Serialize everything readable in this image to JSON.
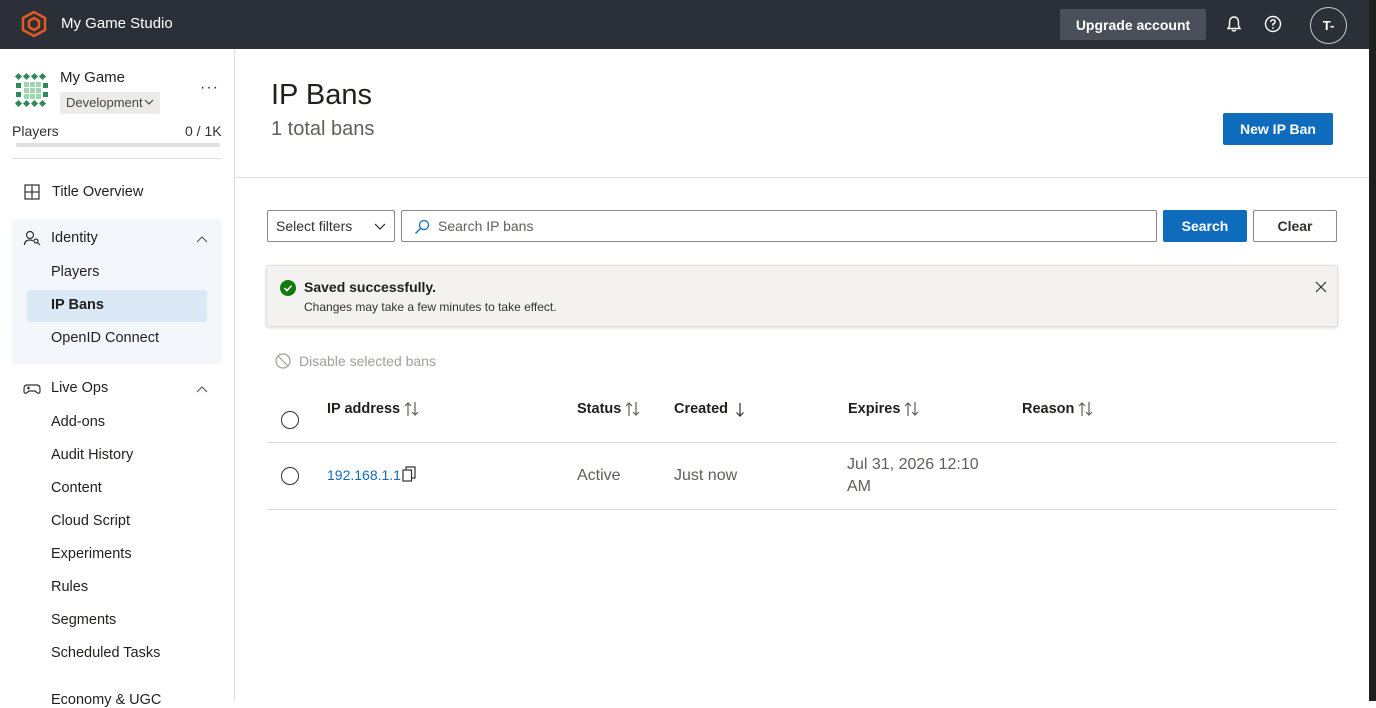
{
  "topbar": {
    "studio_name": "My Game Studio",
    "upgrade_label": "Upgrade account",
    "avatar_initials": "T-"
  },
  "sidebar": {
    "game_name": "My Game",
    "environment": "Development",
    "more_label": "···",
    "players_label": "Players",
    "players_count": "0 / 1K",
    "players_fraction": 0.0,
    "title_overview": "Title Overview",
    "identity": {
      "label": "Identity",
      "items": [
        "Players",
        "IP Bans",
        "OpenID Connect"
      ]
    },
    "live_ops": {
      "label": "Live Ops",
      "items": [
        "Add-ons",
        "Audit History",
        "Content",
        "Cloud Script",
        "Experiments",
        "Rules",
        "Segments",
        "Scheduled Tasks"
      ]
    },
    "partial_item": "Economy & UGC"
  },
  "main": {
    "title": "IP Bans",
    "subtitle": "1 total bans",
    "new_button": "New IP Ban",
    "filter_label": "Select filters",
    "search_placeholder": "Search IP bans",
    "search_button": "Search",
    "clear_button": "Clear",
    "toast": {
      "title": "Saved successfully.",
      "message": "Changes may take a few minutes to take effect."
    },
    "disable_label": "Disable selected bans",
    "table": {
      "headers": [
        "IP address",
        "Status",
        "Created",
        "Expires",
        "Reason"
      ],
      "rows": [
        {
          "ip": "192.168.1.1",
          "status": "Active",
          "created": "Just now",
          "expires_line1": "Jul 31, 2026 12:10",
          "expires_line2": "AM",
          "reason": ""
        }
      ]
    }
  },
  "colors": {
    "topbar_bg": "#2b3038",
    "accent": "#0f6cbd",
    "logo_orange": "#e8581f",
    "success_green": "#107c10"
  }
}
